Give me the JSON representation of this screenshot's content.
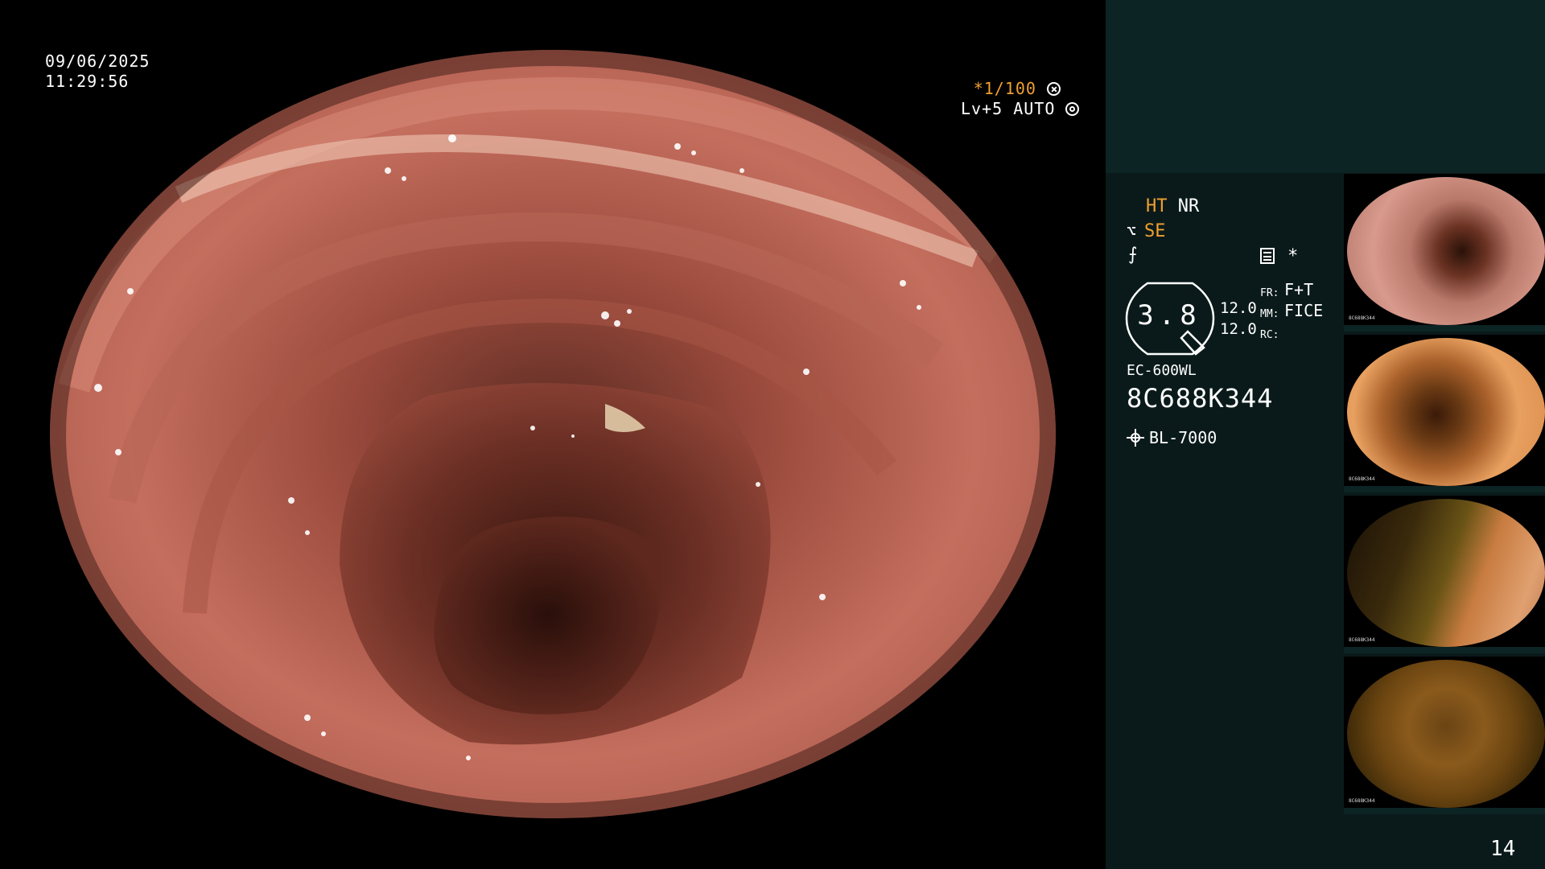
{
  "overlay": {
    "date": "09/06/2025",
    "time": "11:29:56",
    "shutter": "*1/100",
    "level": "Lv+5 AUTO"
  },
  "panel": {
    "ht": "HT",
    "nr": "NR",
    "se": "SE",
    "asterisk": "*",
    "iris_value": "3.8",
    "row1_value": "12.0",
    "row1_label": "FR:",
    "row1_mode": "F+T",
    "row2_value": "12.0",
    "row2_label": "MM:",
    "row2_mode": "FICE",
    "row3_label": "RC:",
    "scope_model": "EC-600WL",
    "scope_serial": "8C688K344",
    "light_source": "BL-7000"
  },
  "thumbnails": [
    {
      "serial": "8C688K344"
    },
    {
      "serial": "8C688K344"
    },
    {
      "serial": "8C688K344"
    },
    {
      "serial": "8C688K344"
    }
  ],
  "page_number": "14",
  "colors": {
    "panel_bg": "#0a1a1a",
    "panel_band": "#0c2424",
    "accent_orange": "#f0a030",
    "mucosa": "#c06a5c"
  },
  "icons": [
    "shutter-icon",
    "auto-icon",
    "structure-icon",
    "color-enhance-icon",
    "memory-icon",
    "light-icon"
  ]
}
